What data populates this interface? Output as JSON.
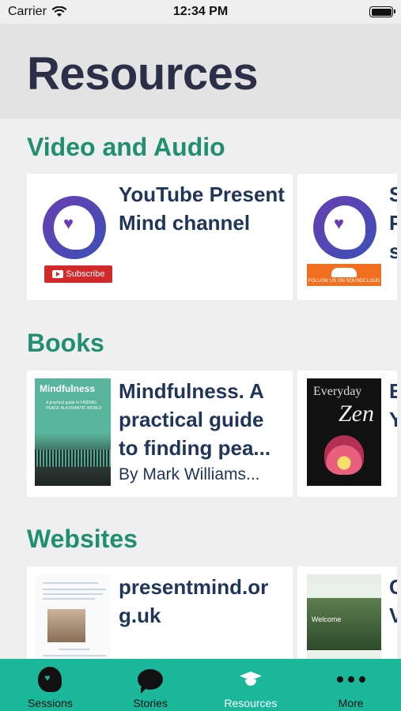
{
  "status_bar": {
    "carrier": "Carrier",
    "time": "12:34 PM"
  },
  "header": {
    "title": "Resources"
  },
  "sections": {
    "video": {
      "title": "Video and Audio",
      "main": {
        "title": "YouTube Present Mind channel",
        "badge": "Subscribe"
      },
      "peek": {
        "text": "S\nP\ns",
        "badge": "FOLLOW US ON SOUNDCLOUD"
      }
    },
    "books": {
      "title": "Books",
      "main": {
        "title": "Mindfulness. A practical guide to finding pea...",
        "subtitle": "By Mark Williams...",
        "cover_title": "Mindfulness",
        "cover_subtitle": "A practical guide to FINDING PEACE IN A FRANTIC WORLD"
      },
      "peek": {
        "text": "E\nY",
        "cover_line1": "Everyday",
        "cover_line2": "Zen"
      }
    },
    "websites": {
      "title": "Websites",
      "main": {
        "title": "presentmind.org.uk"
      },
      "peek": {
        "text": "C\nV",
        "thumb_text": "Welcome"
      }
    }
  },
  "tabs": [
    {
      "label": "Sessions",
      "icon": "head-heart-icon",
      "active": false
    },
    {
      "label": "Stories",
      "icon": "chat-bubble-icon",
      "active": false
    },
    {
      "label": "Resources",
      "icon": "graduation-cap-icon",
      "active": true
    },
    {
      "label": "More",
      "icon": "more-dots-icon",
      "active": false
    }
  ],
  "colors": {
    "accent": "#1bb79b",
    "section_title": "#1f8f6f",
    "card_text": "#1f3559",
    "header_title": "#2c2f48"
  }
}
